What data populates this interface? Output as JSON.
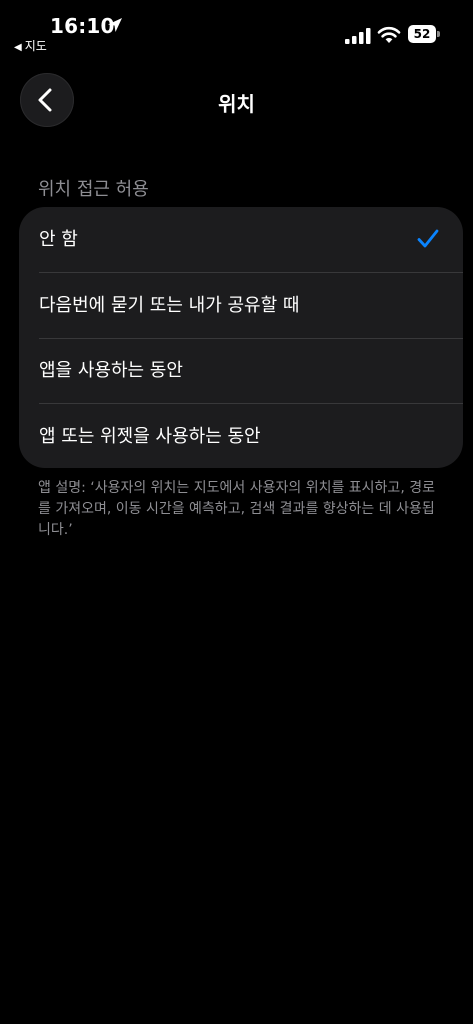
{
  "status_bar": {
    "time": "16:10",
    "back_app_label": "지도",
    "battery_level": "52",
    "icons": [
      "location-arrow-icon",
      "signal-icon",
      "wifi-icon",
      "battery-icon"
    ]
  },
  "nav": {
    "title": "위치",
    "back_icon": "chevron-left-icon"
  },
  "section": {
    "header": "위치 접근 허용",
    "options": [
      {
        "label": "안 함",
        "selected": true
      },
      {
        "label": "다음번에 묻기 또는 내가 공유할 때",
        "selected": false
      },
      {
        "label": "앱을 사용하는 동안",
        "selected": false
      },
      {
        "label": "앱 또는 위젯을 사용하는 동안",
        "selected": false
      }
    ],
    "footer": "앱 설명: ‘사용자의 위치는 지도에서 사용자의 위치를 표시하고, 경로를 가져오며, 이동 시간을 예측하고, 검색 결과를 향상하는 데 사용됩니다.’"
  },
  "colors": {
    "background": "#000000",
    "group_background": "#1c1c1e",
    "accent": "#0a84ff",
    "secondary_text": "#8e8e93",
    "separator": "#38383a"
  }
}
